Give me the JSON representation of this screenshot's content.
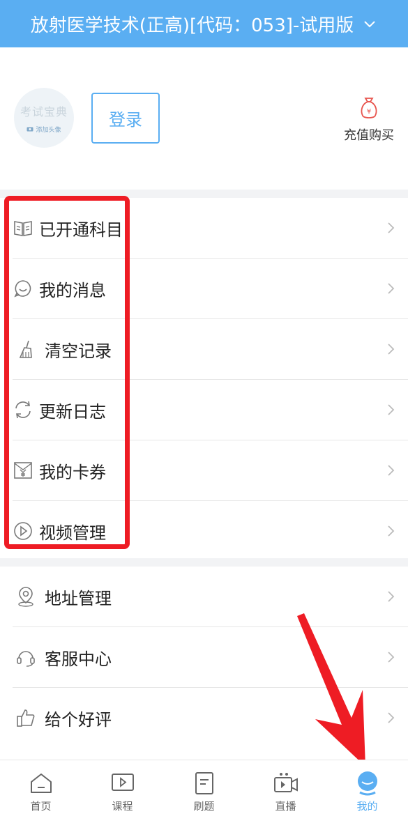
{
  "header": {
    "title": "放射医学技术(正高)[代码：053]-试用版"
  },
  "profile": {
    "avatar_brand": "考试宝典",
    "avatar_add": "添加头像",
    "login_label": "登录",
    "recharge_label": "充值购买",
    "recharge_symbol": "¥"
  },
  "menu1": [
    {
      "label": "已开通科目",
      "icon": "book-icon"
    },
    {
      "label": "我的消息",
      "icon": "message-bubble-icon"
    },
    {
      "label": "清空记录",
      "icon": "broom-icon"
    },
    {
      "label": "更新日志",
      "icon": "refresh-icon"
    },
    {
      "label": "我的卡券",
      "icon": "coupon-icon"
    },
    {
      "label": "视频管理",
      "icon": "play-circle-icon"
    }
  ],
  "menu2": [
    {
      "label": "地址管理",
      "icon": "location-pin-icon"
    },
    {
      "label": "客服中心",
      "icon": "headset-icon"
    },
    {
      "label": "给个好评",
      "icon": "thumbs-up-icon"
    }
  ],
  "tabs": [
    {
      "label": "首页",
      "icon": "home-icon"
    },
    {
      "label": "课程",
      "icon": "course-play-icon"
    },
    {
      "label": "刷题",
      "icon": "document-icon"
    },
    {
      "label": "直播",
      "icon": "live-camera-icon"
    },
    {
      "label": "我的",
      "icon": "profile-icon",
      "active": true
    }
  ],
  "colors": {
    "accent": "#5aaef2",
    "annotation": "#ee1c24",
    "separator": "#f2f3f5"
  }
}
